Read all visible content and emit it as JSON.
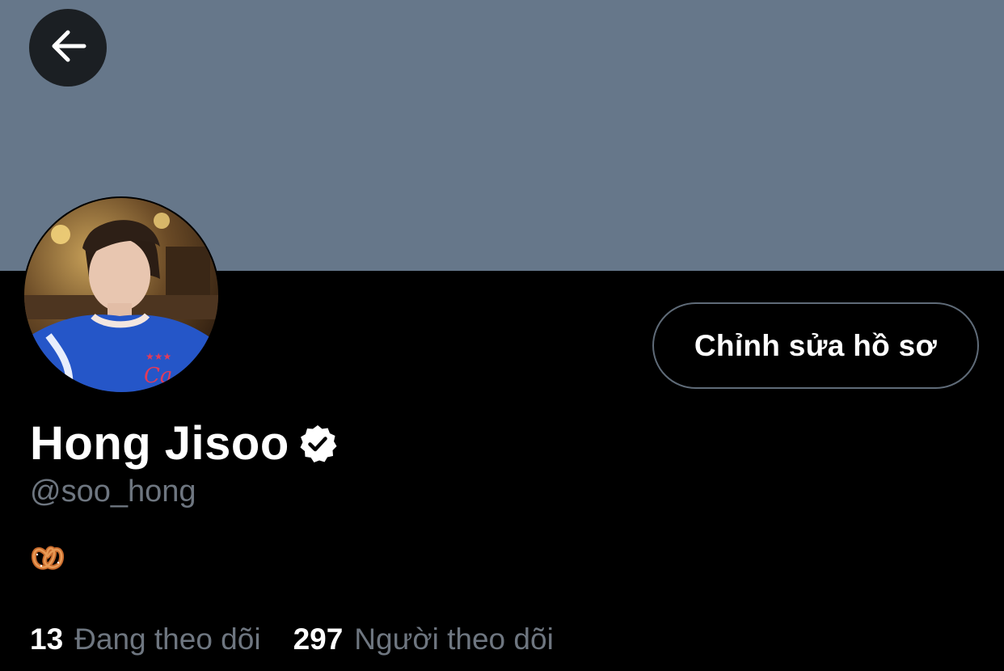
{
  "header": {
    "back_icon": "arrow-left-icon"
  },
  "profile": {
    "banner_color": "#66778a",
    "avatar": "profile-photo",
    "edit_button_label": "Chỉnh sửa hồ sơ",
    "display_name": "Hong Jisoo",
    "verified_icon": "verified-badge-icon",
    "handle": "@soo_hong",
    "bio_icon": "pretzel-emoji"
  },
  "stats": {
    "following_count": "13",
    "following_label": "Đang theo dõi",
    "followers_count": "297",
    "followers_label": "Người theo dõi"
  },
  "colors": {
    "background": "#000000",
    "text": "#ffffff",
    "secondary_text": "#6e7680",
    "button_border": "#5f6b78"
  }
}
